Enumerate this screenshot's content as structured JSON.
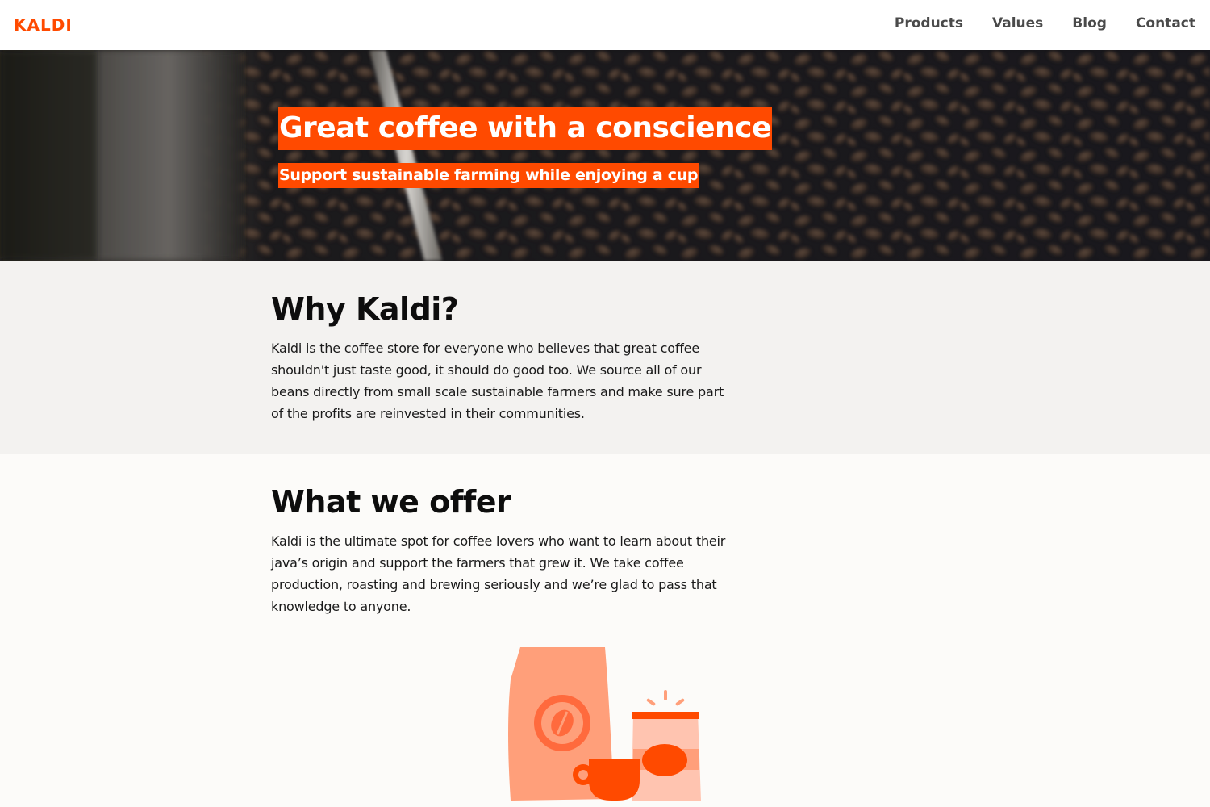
{
  "brand": {
    "name": "KALDI",
    "color": "#ff4a00"
  },
  "nav": {
    "items": [
      {
        "label": "Products"
      },
      {
        "label": "Values"
      },
      {
        "label": "Blog"
      },
      {
        "label": "Contact"
      }
    ]
  },
  "hero": {
    "title": "Great coffee with a conscience",
    "subtitle": "Support sustainable farming while enjoying a cup",
    "highlight_color": "#ff4a00"
  },
  "why": {
    "heading": "Why Kaldi?",
    "text": "Kaldi is the coffee store for everyone who believes that great coffee shouldn't just taste good, it should do good too. We source all of our beans directly from small scale sustainable farmers and make sure part of the profits are reinvested in their communities."
  },
  "offer": {
    "heading": "What we offer",
    "text": "Kaldi is the ultimate spot for coffee lovers who want to learn about their java’s origin and support the farmers that grew it. We take coffee production, roasting and brewing seriously and we’re glad to pass that knowledge to anyone."
  },
  "illustration": {
    "icon": "coffee-bag-cup-icon",
    "colors": [
      "#ff9f7a",
      "#ff4a00",
      "#ffc4b0"
    ]
  }
}
